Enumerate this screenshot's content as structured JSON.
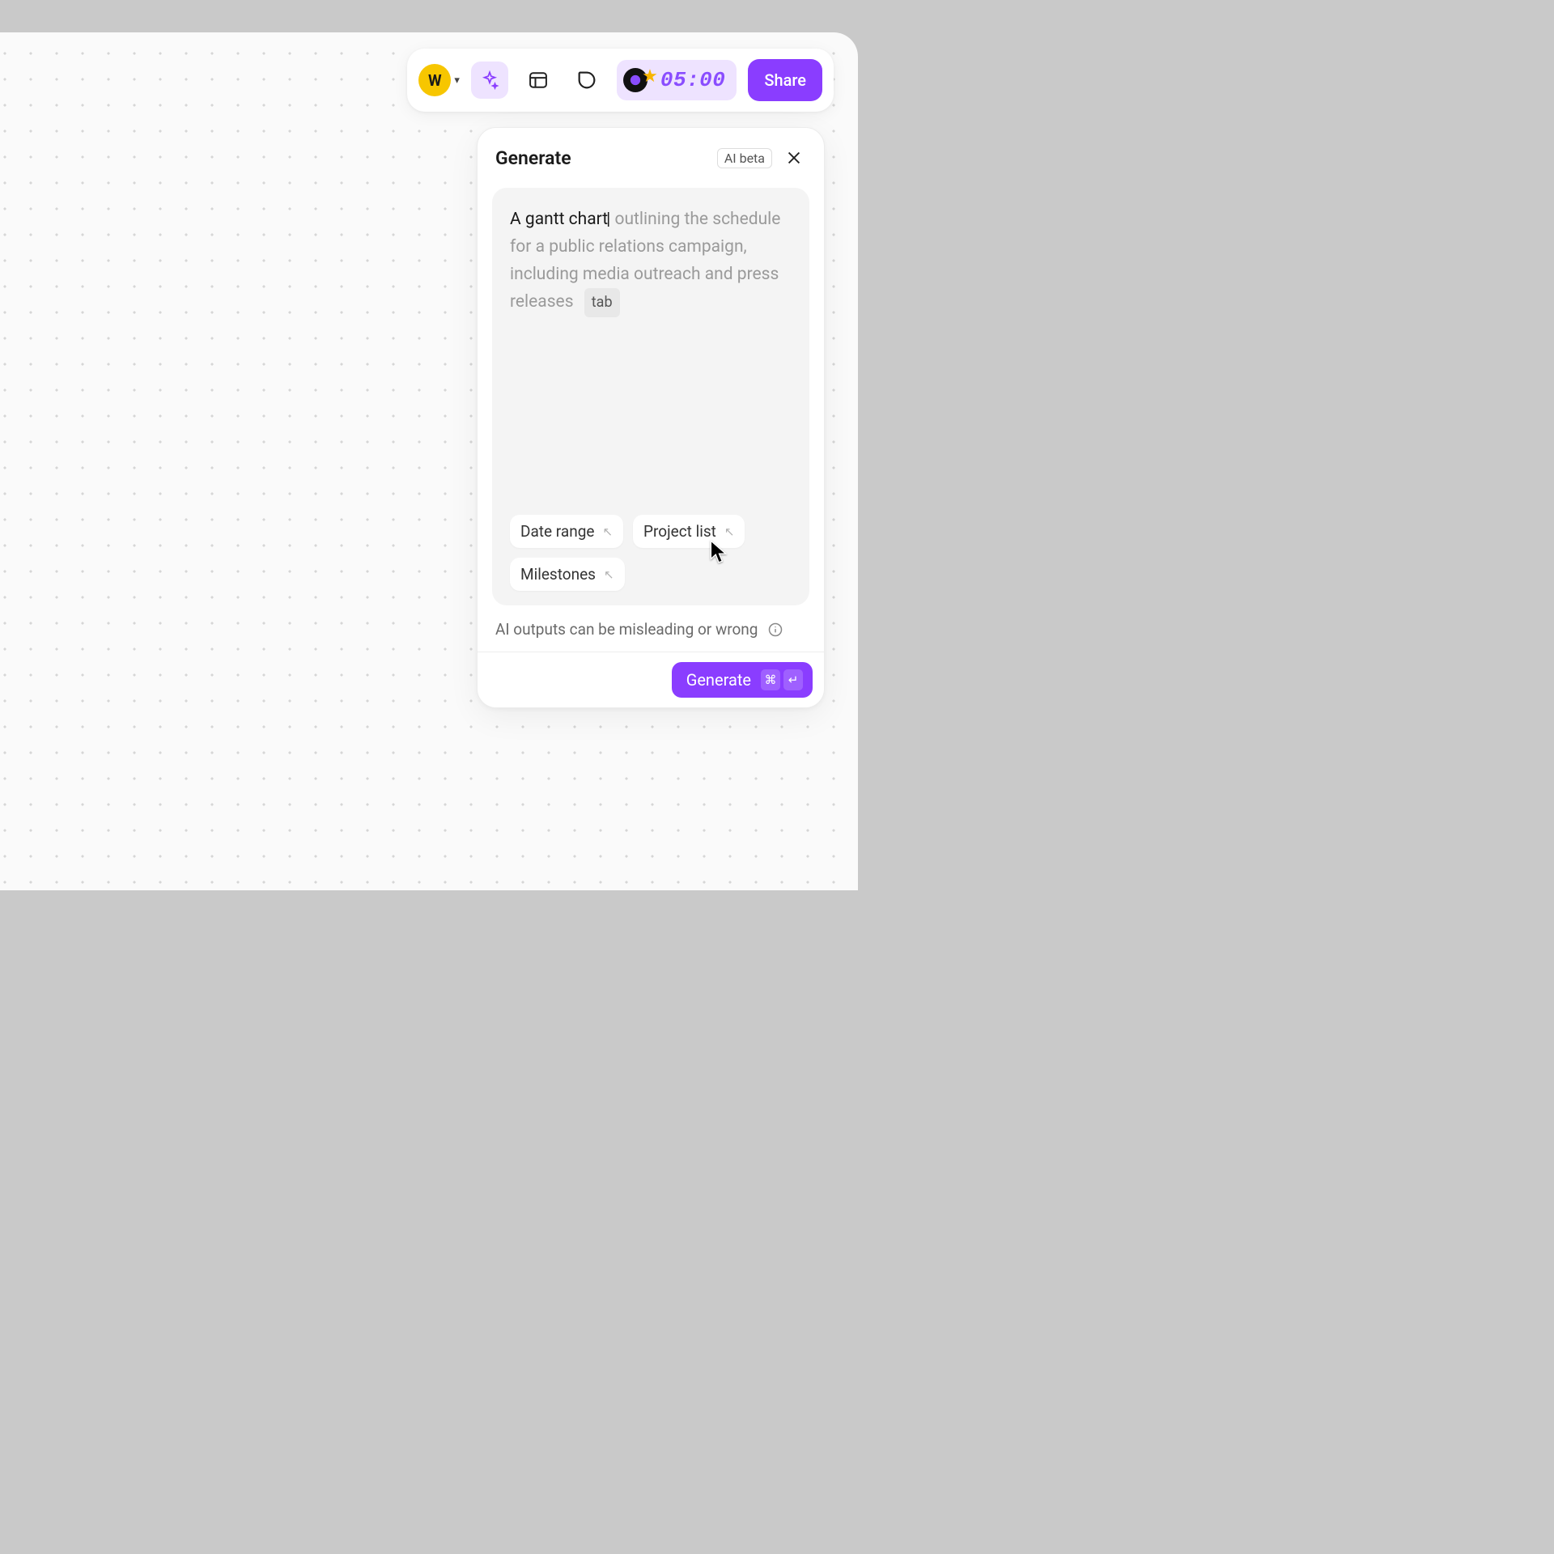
{
  "toolbar": {
    "avatar_initial": "W",
    "timer": "05:00",
    "share_label": "Share"
  },
  "panel": {
    "title": "Generate",
    "beta_badge": "AI beta",
    "prompt": {
      "user_text": "A gantt chart",
      "ghost_text": " outlining the schedule for a public relations campaign, including media outreach and press releases",
      "tab_hint": "tab"
    },
    "chips": [
      "Date range",
      "Project list",
      "Milestones"
    ],
    "disclaimer": "AI outputs can be misleading or wrong",
    "generate_label": "Generate",
    "shortcut": {
      "modifier": "⌘",
      "key": "↵"
    }
  }
}
